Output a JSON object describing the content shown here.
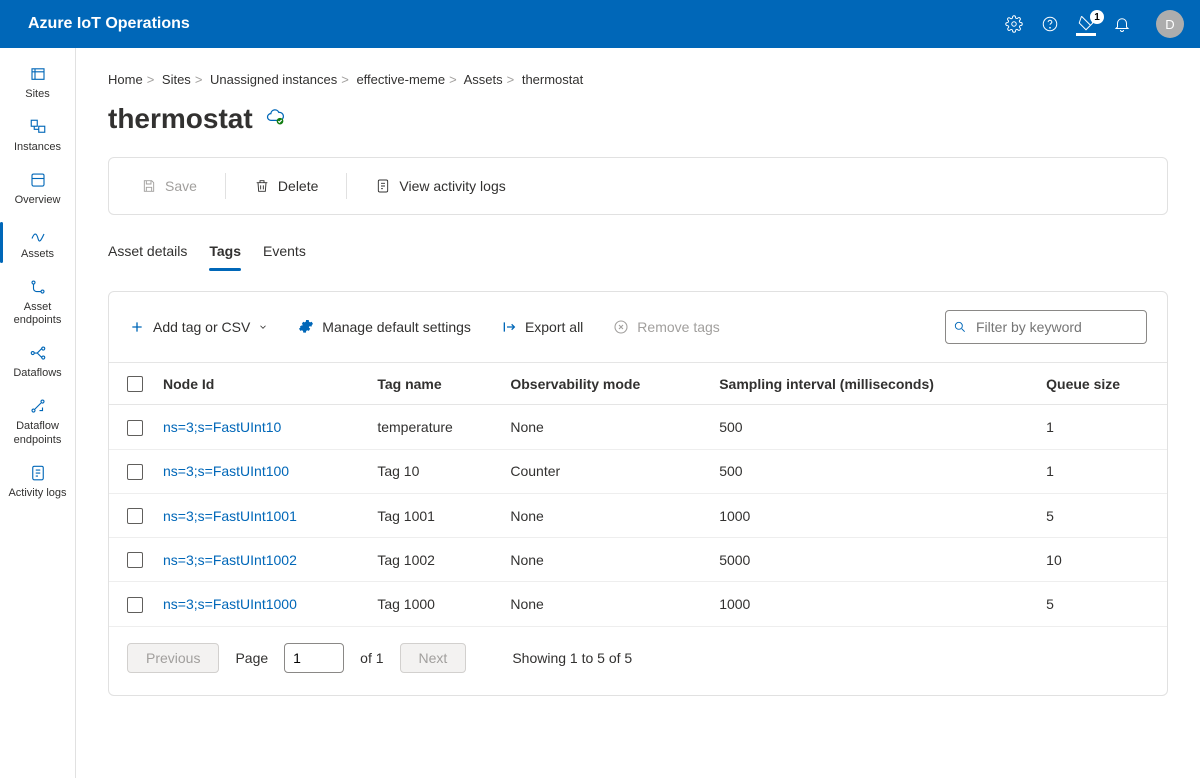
{
  "header": {
    "brand": "Azure IoT Operations",
    "badge_count": "1",
    "avatar_initial": "D"
  },
  "sidebar": {
    "items": [
      {
        "label": "Sites"
      },
      {
        "label": "Instances"
      },
      {
        "label": "Overview"
      },
      {
        "label": "Assets"
      },
      {
        "label": "Asset endpoints"
      },
      {
        "label": "Dataflows"
      },
      {
        "label": "Dataflow endpoints"
      },
      {
        "label": "Activity logs"
      }
    ]
  },
  "breadcrumb": {
    "items": [
      "Home",
      "Sites",
      "Unassigned instances",
      "effective-meme",
      "Assets",
      "thermostat"
    ]
  },
  "page": {
    "title": "thermostat"
  },
  "toolbar": {
    "save_label": "Save",
    "delete_label": "Delete",
    "activity_label": "View activity logs"
  },
  "tabs": {
    "details": "Asset details",
    "tags": "Tags",
    "events": "Events"
  },
  "actions": {
    "add": "Add tag or CSV",
    "manage": "Manage default settings",
    "export": "Export all",
    "remove": "Remove tags",
    "filter_placeholder": "Filter by keyword"
  },
  "table": {
    "headers": {
      "node": "Node Id",
      "tag": "Tag name",
      "obs": "Observability mode",
      "interval": "Sampling interval (milliseconds)",
      "queue": "Queue size"
    },
    "rows": [
      {
        "node": "ns=3;s=FastUInt10",
        "tag": "temperature",
        "obs": "None",
        "interval": "500",
        "queue": "1"
      },
      {
        "node": "ns=3;s=FastUInt100",
        "tag": "Tag 10",
        "obs": "Counter",
        "interval": "500",
        "queue": "1"
      },
      {
        "node": "ns=3;s=FastUInt1001",
        "tag": "Tag 1001",
        "obs": "None",
        "interval": "1000",
        "queue": "5"
      },
      {
        "node": "ns=3;s=FastUInt1002",
        "tag": "Tag 1002",
        "obs": "None",
        "interval": "5000",
        "queue": "10"
      },
      {
        "node": "ns=3;s=FastUInt1000",
        "tag": "Tag 1000",
        "obs": "None",
        "interval": "1000",
        "queue": "5"
      }
    ]
  },
  "pager": {
    "previous": "Previous",
    "next": "Next",
    "page_label": "Page",
    "page_value": "1",
    "of_label": "of 1",
    "showing": "Showing 1 to 5 of 5"
  }
}
